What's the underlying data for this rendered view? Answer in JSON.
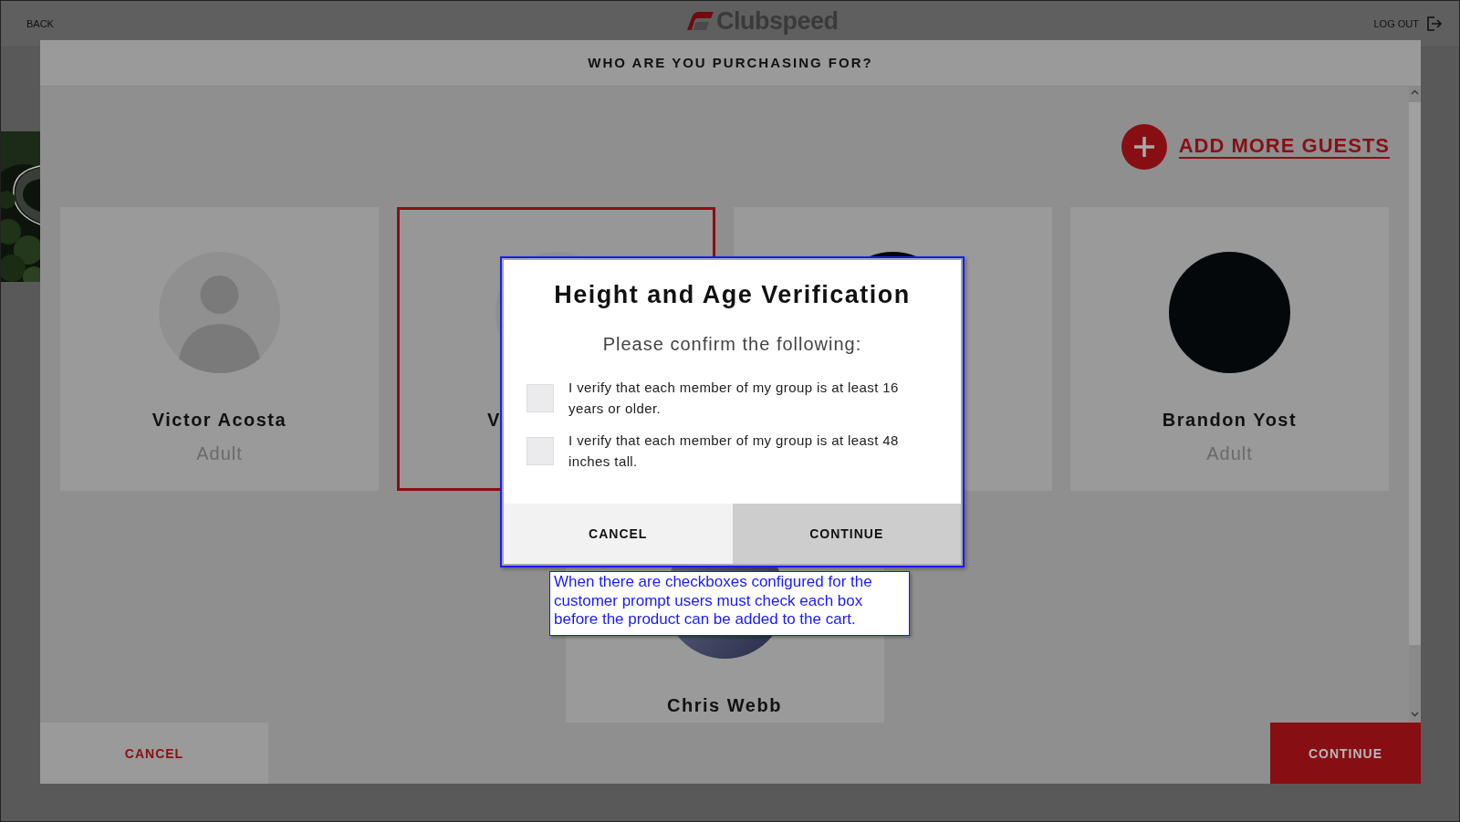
{
  "top_bar": {
    "back": "BACK",
    "logo": "Clubspeed",
    "logout": "LOG OUT"
  },
  "panel": {
    "title": "WHO ARE YOU PURCHASING FOR?",
    "add_guests": "ADD MORE GUESTS",
    "guests": [
      {
        "name": "Victor Acosta",
        "role": "Adult",
        "avatar": {
          "kind": "placeholder"
        },
        "selected": false,
        "kind": "full"
      },
      {
        "name": "V",
        "avatar": {
          "kind": "placeholder"
        },
        "selected": true,
        "kind": "cut"
      },
      {
        "avatar": {
          "kind": "dark"
        },
        "selected": false,
        "kind": "full"
      },
      {
        "name": "Brandon Yost",
        "role": "Adult",
        "avatar": {
          "kind": "dark"
        },
        "selected": false,
        "kind": "full"
      },
      {
        "name": "Chris Webb",
        "avatar": {
          "kind": "blue"
        },
        "selected": false,
        "kind": "full"
      }
    ],
    "cancel": "CANCEL",
    "continue": "CONTINUE"
  },
  "dialog": {
    "title": "Height and Age Verification",
    "subtitle": "Please confirm the following:",
    "checkboxes": [
      {
        "label": "I verify that each member of my group is at least 16 years or older.",
        "checked": false
      },
      {
        "label": "I verify that each member of my group is at least 48 inches tall.",
        "checked": false
      }
    ],
    "buttons": [
      {
        "label": "CANCEL",
        "kind": "secondary"
      },
      {
        "label": "CONTINUE",
        "kind": "primary"
      }
    ]
  },
  "annotation": {
    "text": "When there are checkboxes configured for the customer prompt users must check each box before the product can be added to the cart."
  }
}
